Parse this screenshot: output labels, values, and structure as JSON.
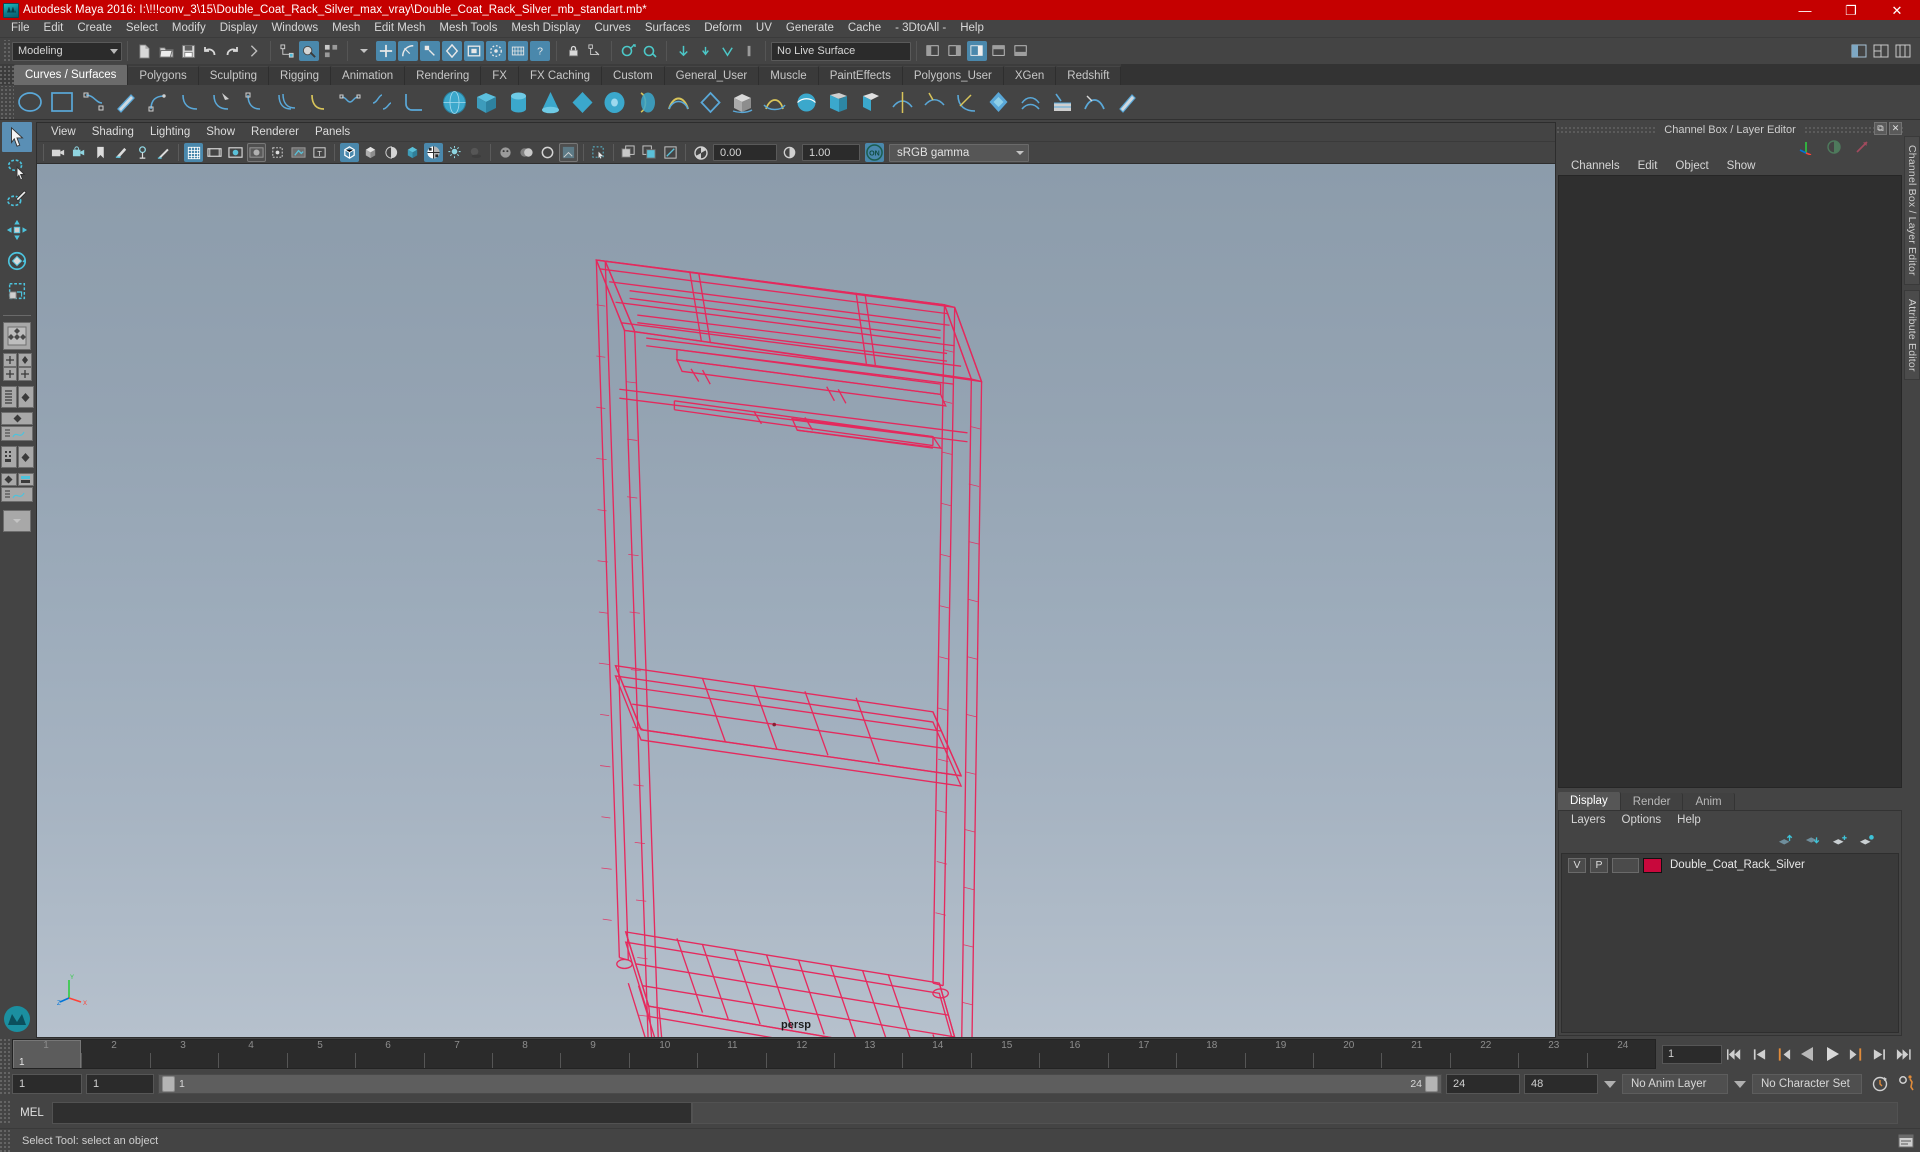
{
  "titlebar": {
    "title": "Autodesk Maya 2016: I:\\!!!conv_3\\15\\Double_Coat_Rack_Silver_max_vray\\Double_Coat_Rack_Silver_mb_standart.mb*",
    "minimize": "—",
    "maximize": "❐",
    "close": "✕",
    "accent_color": "#c50000"
  },
  "menubar": {
    "items": [
      {
        "label": "File"
      },
      {
        "label": "Edit"
      },
      {
        "label": "Create"
      },
      {
        "label": "Select"
      },
      {
        "label": "Modify"
      },
      {
        "label": "Display"
      },
      {
        "label": "Windows"
      },
      {
        "label": "Mesh"
      },
      {
        "label": "Edit Mesh"
      },
      {
        "label": "Mesh Tools"
      },
      {
        "label": "Mesh Display"
      },
      {
        "label": "Curves"
      },
      {
        "label": "Surfaces"
      },
      {
        "label": "Deform"
      },
      {
        "label": "UV"
      },
      {
        "label": "Generate"
      },
      {
        "label": "Cache"
      },
      {
        "label": "- 3DtoAll -"
      },
      {
        "label": "Help"
      }
    ]
  },
  "statusline": {
    "menu_set": "Modeling",
    "live_surface": "No Live Surface",
    "snap_field_value": ""
  },
  "shelf": {
    "tabs": [
      {
        "label": "Curves / Surfaces",
        "active": true
      },
      {
        "label": "Polygons",
        "active": false
      },
      {
        "label": "Sculpting",
        "active": false
      },
      {
        "label": "Rigging",
        "active": false
      },
      {
        "label": "Animation",
        "active": false
      },
      {
        "label": "Rendering",
        "active": false
      },
      {
        "label": "FX",
        "active": false
      },
      {
        "label": "FX Caching",
        "active": false
      },
      {
        "label": "Custom",
        "active": false
      },
      {
        "label": "General_User",
        "active": false
      },
      {
        "label": "Muscle",
        "active": false
      },
      {
        "label": "PaintEffects",
        "active": false
      },
      {
        "label": "Polygons_User",
        "active": false
      },
      {
        "label": "XGen",
        "active": false
      },
      {
        "label": "Redshift",
        "active": false
      }
    ]
  },
  "viewport_panel": {
    "menus": [
      {
        "label": "View"
      },
      {
        "label": "Shading"
      },
      {
        "label": "Lighting"
      },
      {
        "label": "Show"
      },
      {
        "label": "Renderer"
      },
      {
        "label": "Panels"
      }
    ],
    "exposure_value": "0.00",
    "gamma_value": "1.00",
    "color_management_toggle": "ON",
    "color_profile": "sRGB gamma",
    "camera_label": "persp",
    "background_top": "#8c9cab",
    "background_bottom": "#b6c1cd",
    "wireframe_color": "#e8255a"
  },
  "channel_box": {
    "panel_title": "Channel Box / Layer Editor",
    "menus": [
      {
        "label": "Channels"
      },
      {
        "label": "Edit"
      },
      {
        "label": "Object"
      },
      {
        "label": "Show"
      }
    ]
  },
  "layer_editor": {
    "tabs": [
      {
        "label": "Display",
        "active": true
      },
      {
        "label": "Render",
        "active": false
      },
      {
        "label": "Anim",
        "active": false
      }
    ],
    "menus": [
      {
        "label": "Layers"
      },
      {
        "label": "Options"
      },
      {
        "label": "Help"
      }
    ],
    "layers": [
      {
        "visibility": "V",
        "playback": "P",
        "color": "#c8083c",
        "name": "Double_Coat_Rack_Silver"
      }
    ]
  },
  "side_tabs": [
    {
      "label": "Channel Box / Layer Editor"
    },
    {
      "label": "Attribute Editor"
    }
  ],
  "timeline": {
    "start_frame": "1",
    "end_frame": "24",
    "current_frame": "1",
    "current_frame_field": "1",
    "ticks": [
      "1",
      "2",
      "3",
      "4",
      "5",
      "6",
      "7",
      "8",
      "9",
      "10",
      "11",
      "12",
      "13",
      "14",
      "15",
      "16",
      "17",
      "18",
      "19",
      "20",
      "21",
      "22",
      "23",
      "24"
    ]
  },
  "range_slider": {
    "anim_start": "1",
    "range_start": "1",
    "range_bar_label": "1",
    "range_end_label": "24",
    "range_end": "24",
    "anim_end": "48",
    "anim_layer": "No Anim Layer",
    "character_set": "No Character Set"
  },
  "command_line": {
    "language": "MEL",
    "input_value": "",
    "output_value": ""
  },
  "status_bar": {
    "message": "Select Tool: select an object"
  }
}
